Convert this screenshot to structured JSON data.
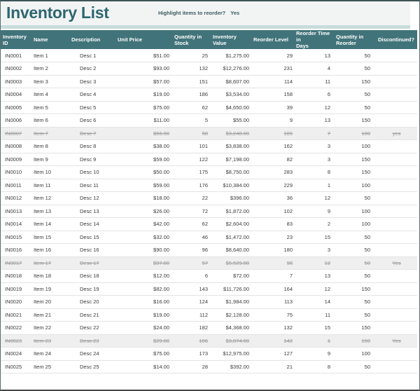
{
  "header": {
    "title": "Inventory List",
    "toggle_label": "Highlight items to reorder?",
    "toggle_value": "Yes"
  },
  "colors": {
    "header_teal": "#41737A",
    "title_text": "#2E6770",
    "accent_stripe": "#C8DCDC",
    "discontinued_text": "#9B9B9B",
    "discontinued_row_bg": "#EFEFEF"
  },
  "table": {
    "columns": [
      "Inventory ID",
      "Name",
      "Description",
      "Unit Price",
      "Quantity in\nStock",
      "Inventory Value",
      "Reorder Level",
      "Reorder Time in\nDays",
      "Quantity in\nReorder",
      "Discontinued?"
    ],
    "rows": [
      {
        "cells": [
          "IN0001",
          "Item 1",
          "Desc 1",
          "$51.00",
          "25",
          "$1,275.00",
          "29",
          "13",
          "50",
          ""
        ],
        "struck": false
      },
      {
        "cells": [
          "IN0002",
          "Item 2",
          "Desc 2",
          "$93.00",
          "132",
          "$12,276.00",
          "231",
          "4",
          "50",
          ""
        ],
        "struck": false
      },
      {
        "cells": [
          "IN0003",
          "Item 3",
          "Desc 3",
          "$57.00",
          "151",
          "$8,607.00",
          "114",
          "11",
          "150",
          ""
        ],
        "struck": false
      },
      {
        "cells": [
          "IN0004",
          "Item 4",
          "Desc 4",
          "$19.00",
          "186",
          "$3,534.00",
          "158",
          "6",
          "50",
          ""
        ],
        "struck": false
      },
      {
        "cells": [
          "IN0005",
          "Item 5",
          "Desc 5",
          "$75.00",
          "62",
          "$4,650.00",
          "39",
          "12",
          "50",
          ""
        ],
        "struck": false
      },
      {
        "cells": [
          "IN0006",
          "Item 6",
          "Desc 6",
          "$11.00",
          "5",
          "$55.00",
          "9",
          "13",
          "150",
          ""
        ],
        "struck": false
      },
      {
        "cells": [
          "IN0007",
          "Item 7",
          "Desc 7",
          "$56.00",
          "58",
          "$3,248.00",
          "109",
          "7",
          "100",
          "yes"
        ],
        "struck": true
      },
      {
        "cells": [
          "IN0008",
          "Item 8",
          "Desc 8",
          "$38.00",
          "101",
          "$3,838.00",
          "162",
          "3",
          "100",
          ""
        ],
        "struck": false
      },
      {
        "cells": [
          "IN0009",
          "Item 9",
          "Desc 9",
          "$59.00",
          "122",
          "$7,198.00",
          "82",
          "3",
          "150",
          ""
        ],
        "struck": false
      },
      {
        "cells": [
          "IN0010",
          "Item 10",
          "Desc 10",
          "$50.00",
          "175",
          "$8,750.00",
          "283",
          "8",
          "150",
          ""
        ],
        "struck": false
      },
      {
        "cells": [
          "IN0011",
          "Item 11",
          "Desc 11",
          "$59.00",
          "176",
          "$10,384.00",
          "229",
          "1",
          "100",
          ""
        ],
        "struck": false
      },
      {
        "cells": [
          "IN0012",
          "Item 12",
          "Desc 12",
          "$18.00",
          "22",
          "$396.00",
          "36",
          "12",
          "50",
          ""
        ],
        "struck": false
      },
      {
        "cells": [
          "IN0013",
          "Item 13",
          "Desc 13",
          "$26.00",
          "72",
          "$1,872.00",
          "102",
          "9",
          "100",
          ""
        ],
        "struck": false
      },
      {
        "cells": [
          "IN0014",
          "Item 14",
          "Desc 14",
          "$42.00",
          "62",
          "$2,604.00",
          "83",
          "2",
          "100",
          ""
        ],
        "struck": false
      },
      {
        "cells": [
          "IN0015",
          "Item 15",
          "Desc 15",
          "$32.00",
          "46",
          "$1,472.00",
          "23",
          "15",
          "50",
          ""
        ],
        "struck": false
      },
      {
        "cells": [
          "IN0016",
          "Item 16",
          "Desc 16",
          "$90.00",
          "96",
          "$8,640.00",
          "180",
          "3",
          "50",
          ""
        ],
        "struck": false
      },
      {
        "cells": [
          "IN0017",
          "Item 17",
          "Desc 17",
          "$97.00",
          "57",
          "$5,529.00",
          "98",
          "12",
          "50",
          "Yes"
        ],
        "struck": true
      },
      {
        "cells": [
          "IN0018",
          "Item 18",
          "Desc 18",
          "$12.00",
          "6",
          "$72.00",
          "7",
          "13",
          "50",
          ""
        ],
        "struck": false
      },
      {
        "cells": [
          "IN0019",
          "Item 19",
          "Desc 19",
          "$82.00",
          "143",
          "$11,726.00",
          "164",
          "12",
          "150",
          ""
        ],
        "struck": false
      },
      {
        "cells": [
          "IN0020",
          "Item 20",
          "Desc 20",
          "$16.00",
          "124",
          "$1,984.00",
          "113",
          "14",
          "50",
          ""
        ],
        "struck": false
      },
      {
        "cells": [
          "IN0021",
          "Item 21",
          "Desc 21",
          "$19.00",
          "112",
          "$2,128.00",
          "75",
          "11",
          "50",
          ""
        ],
        "struck": false
      },
      {
        "cells": [
          "IN0022",
          "Item 22",
          "Desc 22",
          "$24.00",
          "182",
          "$4,368.00",
          "132",
          "15",
          "150",
          ""
        ],
        "struck": false
      },
      {
        "cells": [
          "IN0023",
          "Item 23",
          "Desc 23",
          "$29.00",
          "106",
          "$3,074.00",
          "142",
          "1",
          "150",
          "Yes"
        ],
        "struck": true
      },
      {
        "cells": [
          "IN0024",
          "Item 24",
          "Desc 24",
          "$75.00",
          "173",
          "$12,975.00",
          "127",
          "9",
          "100",
          ""
        ],
        "struck": false
      },
      {
        "cells": [
          "IN0025",
          "Item 25",
          "Desc 25",
          "$14.00",
          "28",
          "$392.00",
          "21",
          "8",
          "50",
          ""
        ],
        "struck": false
      }
    ]
  }
}
